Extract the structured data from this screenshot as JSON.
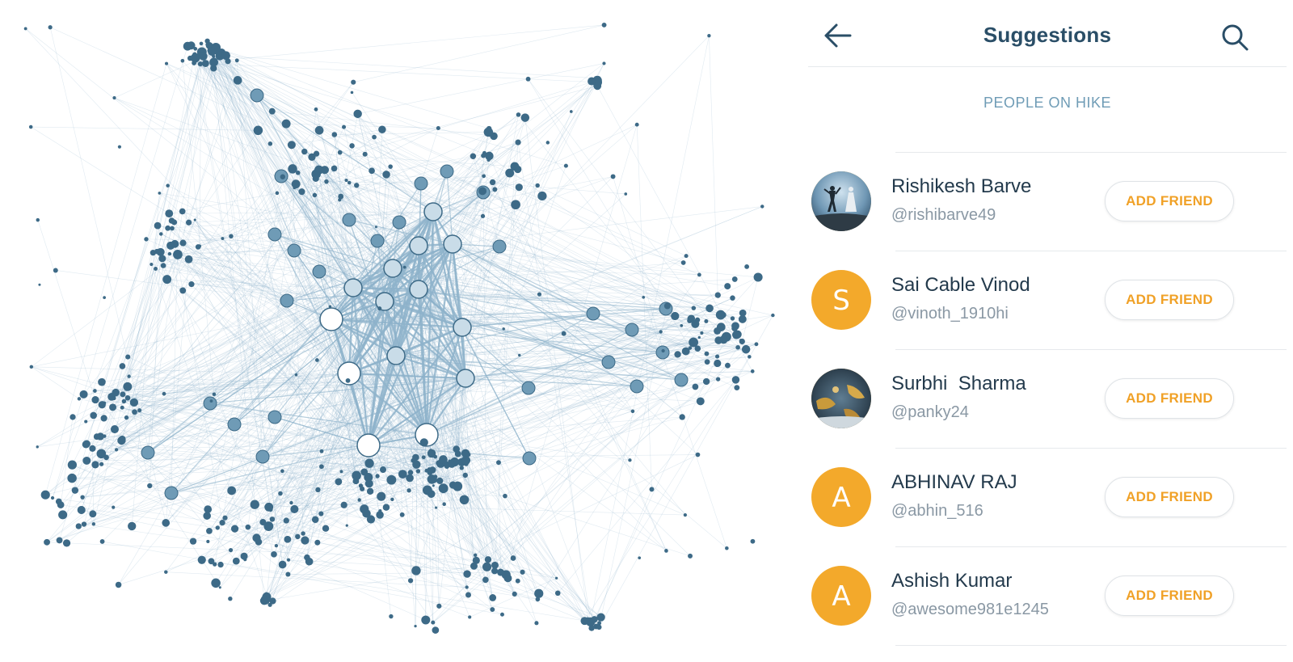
{
  "header": {
    "title": "Suggestions",
    "back_icon": "arrow-left-icon",
    "search_icon": "search-icon"
  },
  "section": {
    "heading": "PEOPLE ON HIKE"
  },
  "suggestions": [
    {
      "name": "Rishikesh Barve",
      "handle": "@rishibarve49",
      "avatar": "photo"
    },
    {
      "name": "Sai Cable Vinod",
      "handle": "@vinoth_1910hi",
      "avatar": "S"
    },
    {
      "name": "Surbhi  Sharma",
      "handle": "@panky24",
      "avatar": "photo"
    },
    {
      "name": "ABHINAV RAJ",
      "handle": "@abhin_516",
      "avatar": "A"
    },
    {
      "name": "Ashish Kumar",
      "handle": "@awesome981e1245",
      "avatar": "A"
    }
  ],
  "buttons": {
    "add_friend_label": "ADD FRIEND"
  },
  "colors": {
    "title": "#2a4e67",
    "accent_orange": "#f3a92b",
    "add_friend_text": "#f0a127",
    "section_heading": "#6f9cb6",
    "network_node": "#3d6a87",
    "network_edge": "#8fb4cb"
  }
}
